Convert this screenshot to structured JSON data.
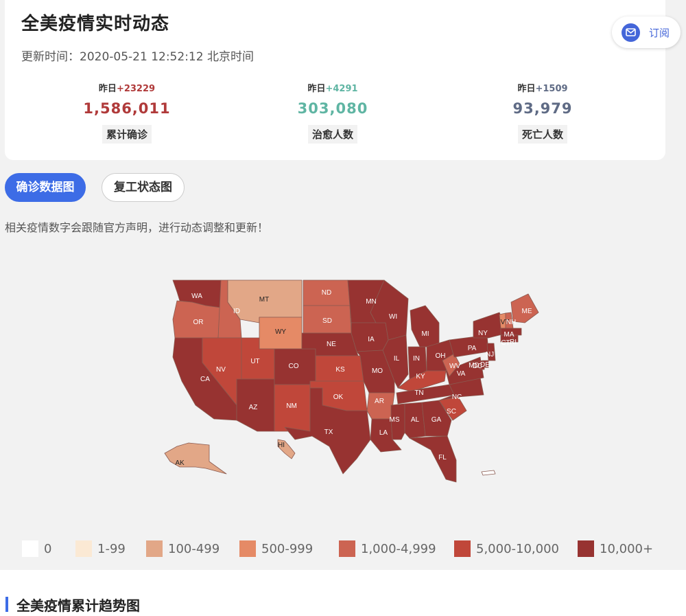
{
  "header": {
    "title": "全美疫情实时动态",
    "update_time": "更新时间：2020-05-21 12:52:12 北京时间",
    "subscribe_label": "订阅"
  },
  "stats": [
    {
      "yesterday_prefix": "昨日",
      "yesterday_delta": "+23229",
      "value": "1,586,011",
      "label": "累计确诊",
      "color": "#b03a3a"
    },
    {
      "yesterday_prefix": "昨日",
      "yesterday_delta": "+4291",
      "value": "303,080",
      "label": "治愈人数",
      "color": "#5fb5a3"
    },
    {
      "yesterday_prefix": "昨日",
      "yesterday_delta": "+1509",
      "value": "93,979",
      "label": "死亡人数",
      "color": "#5f6b85"
    }
  ],
  "tabs": {
    "confirmed_map": "确诊数据图",
    "reopen_map": "复工状态图"
  },
  "notice": "相关疫情数字会跟随官方声明，进行动态调整和更新！",
  "map": {
    "states": [
      {
        "code": "WA",
        "bin": 6
      },
      {
        "code": "OR",
        "bin": 4
      },
      {
        "code": "CA",
        "bin": 6
      },
      {
        "code": "ID",
        "bin": 4
      },
      {
        "code": "NV",
        "bin": 5
      },
      {
        "code": "MT",
        "bin": 2
      },
      {
        "code": "WY",
        "bin": 3
      },
      {
        "code": "UT",
        "bin": 5
      },
      {
        "code": "AZ",
        "bin": 6
      },
      {
        "code": "CO",
        "bin": 6
      },
      {
        "code": "NM",
        "bin": 5
      },
      {
        "code": "ND",
        "bin": 4
      },
      {
        "code": "SD",
        "bin": 4
      },
      {
        "code": "NE",
        "bin": 6
      },
      {
        "code": "KS",
        "bin": 5
      },
      {
        "code": "OK",
        "bin": 5
      },
      {
        "code": "TX",
        "bin": 6
      },
      {
        "code": "MN",
        "bin": 6
      },
      {
        "code": "IA",
        "bin": 6
      },
      {
        "code": "MO",
        "bin": 6
      },
      {
        "code": "AR",
        "bin": 4
      },
      {
        "code": "LA",
        "bin": 6
      },
      {
        "code": "WI",
        "bin": 6
      },
      {
        "code": "IL",
        "bin": 6
      },
      {
        "code": "MI",
        "bin": 6
      },
      {
        "code": "IN",
        "bin": 6
      },
      {
        "code": "OH",
        "bin": 6
      },
      {
        "code": "KY",
        "bin": 5
      },
      {
        "code": "TN",
        "bin": 6
      },
      {
        "code": "MS",
        "bin": 6
      },
      {
        "code": "AL",
        "bin": 6
      },
      {
        "code": "GA",
        "bin": 6
      },
      {
        "code": "FL",
        "bin": 6
      },
      {
        "code": "SC",
        "bin": 5
      },
      {
        "code": "NC",
        "bin": 6
      },
      {
        "code": "VA",
        "bin": 6
      },
      {
        "code": "WV",
        "bin": 4
      },
      {
        "code": "PA",
        "bin": 6
      },
      {
        "code": "NY",
        "bin": 6
      },
      {
        "code": "NJ",
        "bin": 6
      },
      {
        "code": "DE",
        "bin": 6
      },
      {
        "code": "MD",
        "bin": 6
      },
      {
        "code": "DC",
        "bin": 6
      },
      {
        "code": "VT",
        "bin": 3
      },
      {
        "code": "NH",
        "bin": 4
      },
      {
        "code": "ME",
        "bin": 4
      },
      {
        "code": "MA",
        "bin": 6
      },
      {
        "code": "CT",
        "bin": 6
      },
      {
        "code": "RI",
        "bin": 6
      },
      {
        "code": "AK",
        "bin": 2
      },
      {
        "code": "HI",
        "bin": 2
      }
    ]
  },
  "legend": [
    {
      "label": "0",
      "color": "#ffffff"
    },
    {
      "label": "1-99",
      "color": "#fbe9d4"
    },
    {
      "label": "100-499",
      "color": "#e2a787"
    },
    {
      "label": "500-999",
      "color": "#e58a66"
    },
    {
      "label": "1,000-4,999",
      "color": "#cc6452"
    },
    {
      "label": "5,000-10,000",
      "color": "#c0473a"
    },
    {
      "label": "10,000+",
      "color": "#973331"
    }
  ],
  "section": {
    "trend_title": "全美疫情累计趋势图"
  }
}
